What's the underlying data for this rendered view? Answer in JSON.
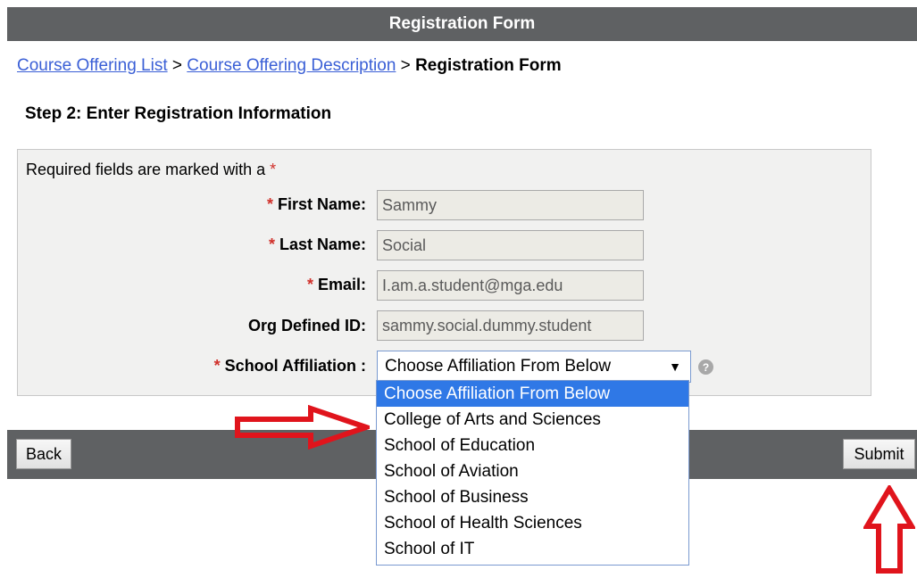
{
  "header": {
    "title": "Registration Form"
  },
  "breadcrumb": {
    "items": [
      "Course Offering List",
      "Course Offering Description"
    ],
    "separator": ">",
    "current": "Registration Form"
  },
  "step": {
    "heading": "Step 2: Enter Registration Information"
  },
  "form": {
    "required_note": "Required fields are marked with a",
    "required_marker": "*",
    "fields": {
      "first_name": {
        "label": "First Name:",
        "value": "Sammy"
      },
      "last_name": {
        "label": "Last Name:",
        "value": "Social"
      },
      "email": {
        "label": "Email:",
        "value": "I.am.a.student@mga.edu"
      },
      "org_id": {
        "label": "Org Defined ID:",
        "value": "sammy.social.dummy.student"
      },
      "school": {
        "label": "School Affiliation :",
        "value": "Choose Affiliation From Below",
        "caret": "▼"
      }
    },
    "help_icon": "?",
    "options": [
      "Choose Affiliation From Below",
      "College of Arts and Sciences",
      "School of Education",
      "School of Aviation",
      "School of Business",
      "School of Health Sciences",
      "School of IT"
    ]
  },
  "buttons": {
    "back": "Back",
    "submit": "Submit"
  },
  "colors": {
    "bar": "#5f6163",
    "link": "#3a5fd6",
    "required": "#d0302a",
    "selection": "#2f78e6",
    "annotation": "#e0141c"
  }
}
